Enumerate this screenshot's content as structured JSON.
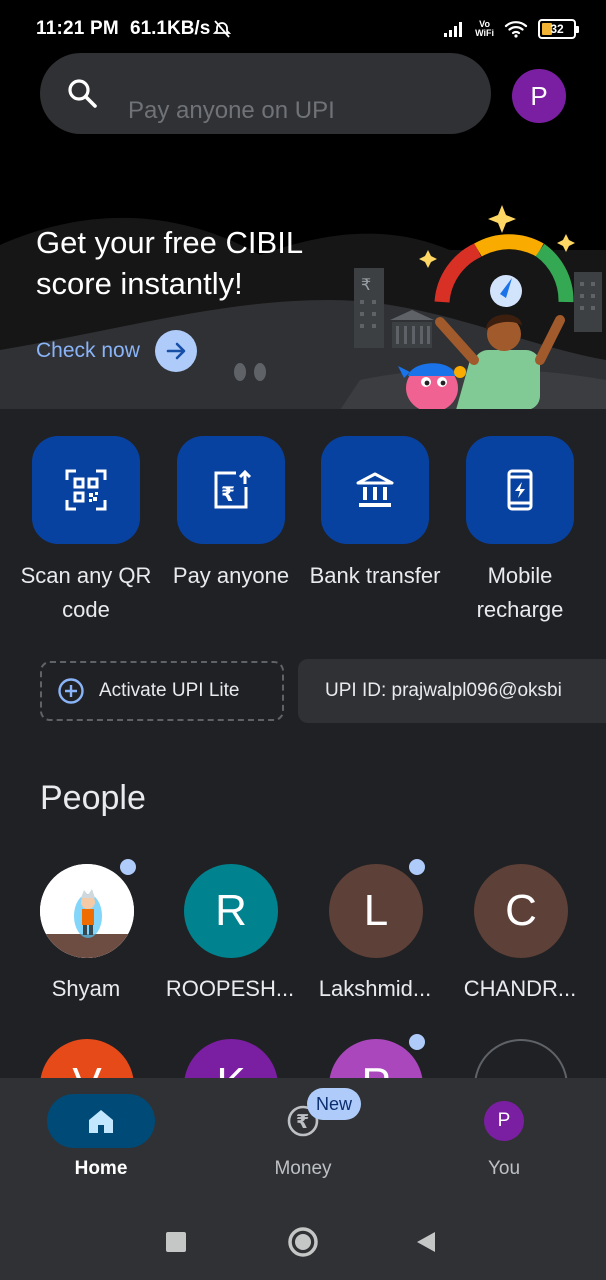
{
  "status_bar": {
    "time": "11:21 PM",
    "net_speed": "61.1KB/s",
    "vowifi": [
      "Vo",
      "WiFi"
    ],
    "battery_level": "32"
  },
  "search": {
    "placeholder": "Pay anyone on UPI",
    "icon": "search-icon"
  },
  "profile": {
    "initial": "P",
    "color": "#7b1fa2"
  },
  "banner": {
    "title": "Get your free CIBIL score instantly!",
    "cta_label": "Check now"
  },
  "quick_actions": [
    {
      "label": "Scan any QR code",
      "icon": "qr-scan-icon"
    },
    {
      "label": "Pay anyone",
      "icon": "pay-anyone-icon"
    },
    {
      "label": "Bank transfer",
      "icon": "bank-icon"
    },
    {
      "label": "Mobile recharge",
      "icon": "mobile-recharge-icon"
    }
  ],
  "upi": {
    "lite_label": "Activate UPI Lite",
    "id_text": "UPI ID: prajwalpl096@oksbi"
  },
  "people": {
    "title": "People",
    "contacts": [
      {
        "name": "Shyam",
        "initial": "",
        "color": "#ffffff",
        "has_new": true
      },
      {
        "name": "ROOPESH...",
        "initial": "R",
        "color": "#00838f",
        "has_new": false
      },
      {
        "name": "Lakshmid...",
        "initial": "L",
        "color": "#5d4037",
        "has_new": true
      },
      {
        "name": "CHANDR...",
        "initial": "C",
        "color": "#5d4037",
        "has_new": false
      }
    ],
    "second_row": [
      {
        "initial": "V",
        "color": "#e64a19"
      },
      {
        "initial": "K",
        "color": "#7b1fa2"
      },
      {
        "initial": "P",
        "color": "#ab47bc"
      },
      {
        "initial": "",
        "color": "#202124"
      }
    ]
  },
  "bottom_nav": {
    "items": [
      {
        "label": "Home",
        "icon": "home-icon",
        "active": true
      },
      {
        "label": "Money",
        "icon": "rupee-icon",
        "active": false,
        "badge": "New"
      },
      {
        "label": "You",
        "icon": "avatar",
        "active": false
      }
    ],
    "you_initial": "P"
  },
  "colors": {
    "accent": "#8ab4f8",
    "tile": "#0842a0",
    "panel": "#202124",
    "surface": "#303134"
  }
}
